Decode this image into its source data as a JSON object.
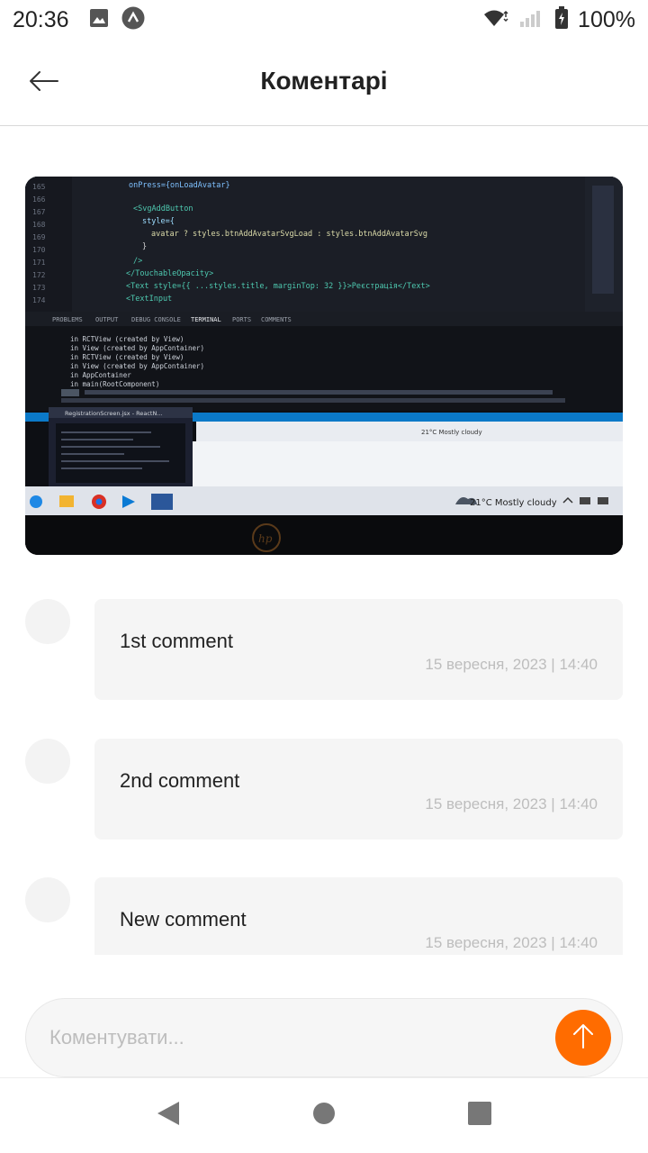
{
  "status_bar": {
    "time": "20:36",
    "battery": "100%",
    "icons": [
      "image-icon",
      "app-notification-icon",
      "wifi-icon",
      "signal-icon",
      "battery-icon"
    ]
  },
  "header": {
    "title": "Коментарі",
    "back_icon": "arrow-left-icon"
  },
  "post": {
    "photo_icon": "laptop-screen-photo",
    "photo_texts": {
      "weather": "21°C Mostly cloudy",
      "window_title": "RegistrationScreen.jsx - ReactN...",
      "code_line_1": "onPress={onLoadAvatar}",
      "code_line_2": "<SvgAddButton",
      "code_line_3": "avatar ? styles.btnAddAvatarSvgLoad : styles.btnAddAvatarSvg",
      "code_line_4": "<Text style={{ ...styles.title, marginTop: 32 }}>Реєстрація</Text>",
      "code_line_5": "<TextInput",
      "terminal_line_1": "in RCTView (created by View)",
      "terminal_line_2": "in View (created by AppContainer)",
      "terminal_line_3": "in RCTView (created by View)",
      "terminal_line_4": "in View (created by AppContainer)",
      "terminal_line_5": "in AppContainer",
      "terminal_line_6": "in main(RootComponent)"
    }
  },
  "comments": [
    {
      "text": "1st comment",
      "date": "15 вересня, 2023 | 14:40"
    },
    {
      "text": "2nd comment",
      "date": "15 вересня, 2023 | 14:40"
    },
    {
      "text": "New comment",
      "date": "15 вересня, 2023 | 14:40"
    }
  ],
  "input": {
    "placeholder": "Коментувати...",
    "value": "",
    "send_icon": "arrow-up-icon"
  },
  "nav": {
    "back_icon": "nav-back-icon",
    "home_icon": "nav-home-icon",
    "recents_icon": "nav-recents-icon"
  },
  "colors": {
    "accent": "#FF6C00",
    "bubble": "#F5F5F5",
    "avatar": "#F3F3F3",
    "date_text": "#BDBDBD"
  }
}
